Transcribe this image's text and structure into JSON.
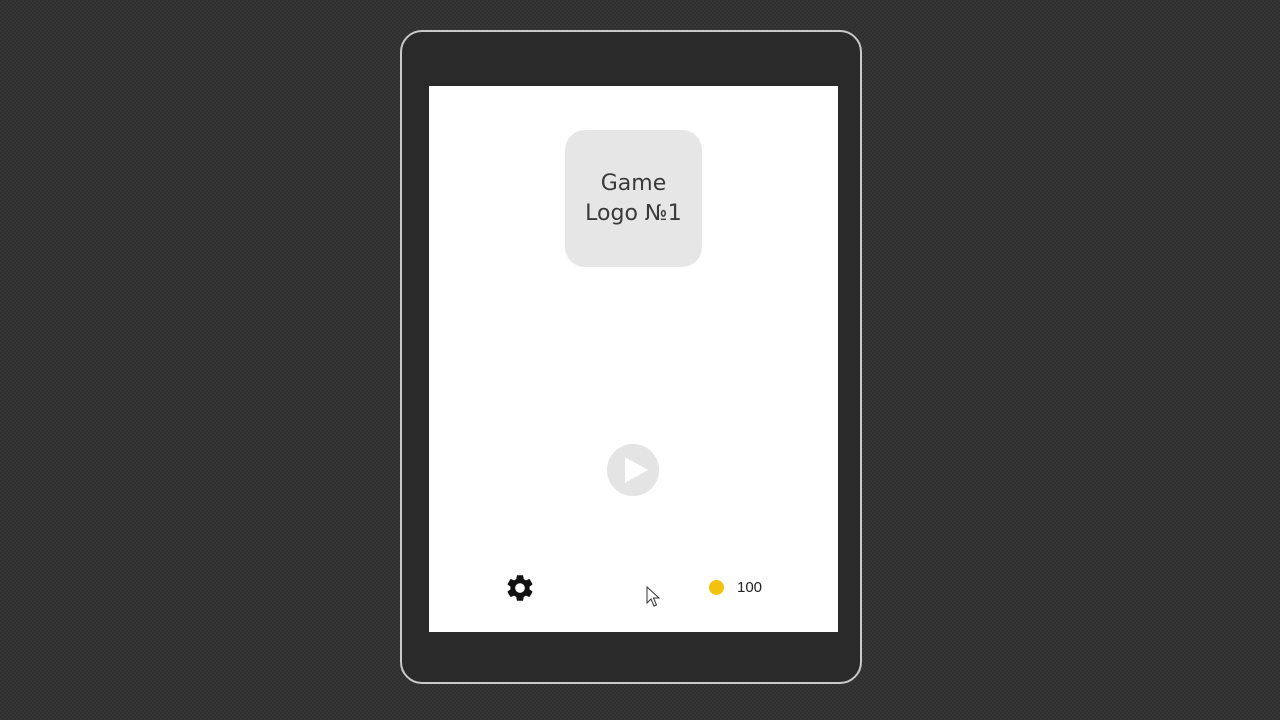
{
  "game": {
    "logo_text": "Game Logo №1",
    "coins": "100",
    "icons": {
      "play": "play-icon",
      "settings": "gear-icon",
      "coin": "coin-icon",
      "cursor": "mouse-cursor-icon"
    }
  },
  "colors": {
    "backdrop": "#2f2f2f",
    "device_frame": "#2a2a2a",
    "device_border": "#c9c9c9",
    "screen": "#ffffff",
    "logo_tile": "#e6e6e6",
    "play_button": "#e8e8e8",
    "coin": "#f2c20d"
  }
}
